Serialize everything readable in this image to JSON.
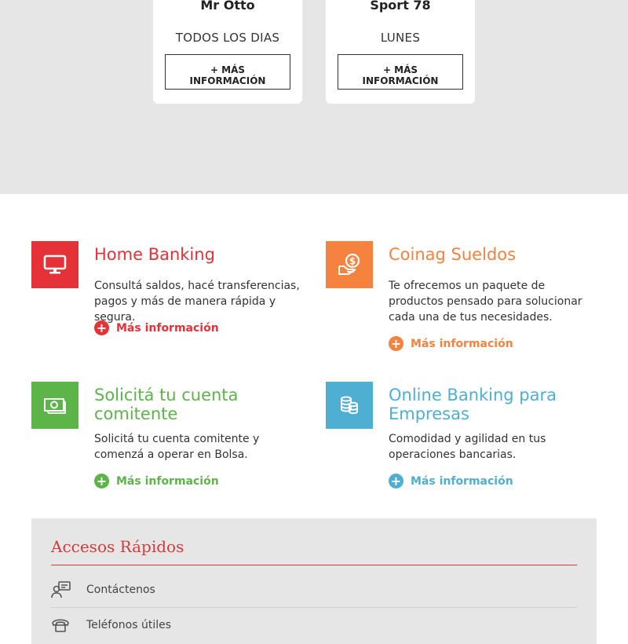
{
  "promos": [
    {
      "name": "Mr Otto",
      "day": "TODOS LOS DIAS",
      "more_label": "+ MÁS\nINFORMACIÓN"
    },
    {
      "name": "Sport 78",
      "day": "LUNES",
      "more_label": "+ MÁS\nINFORMACIÓN"
    }
  ],
  "services": [
    {
      "title": "Home Banking",
      "desc": "Consultá saldos, hacé transferencias, pagos y más de manera rápida y segura.",
      "more": "Más información",
      "color": "#e53238",
      "icon": "monitor-icon"
    },
    {
      "title": "Coinag Sueldos",
      "desc": "Te ofrecemos un paquete de productos pensado para solucionar cada una de tus necesidades.",
      "more": "Más información",
      "color": "#f5823e",
      "icon": "money-hand-icon"
    },
    {
      "title": "Solicitá tu cuenta comitente",
      "desc": "Solicitá tu cuenta comitente y comenzá a operar en Bolsa.",
      "more": "Más información",
      "color": "#5db54a",
      "icon": "banknote-icon"
    },
    {
      "title": "Online Banking para Empresas",
      "desc": "Comodidad y agilidad en tus operaciones bancarias.",
      "more": "Más información",
      "color": "#4fafd2",
      "icon": "coins-stack-icon"
    }
  ],
  "quick_access": {
    "title": "Accesos Rápidos",
    "items": [
      {
        "label": "Contáctenos",
        "icon": "contact-person-icon"
      },
      {
        "label": "Teléfonos útiles",
        "icon": "phone-icon"
      }
    ]
  }
}
